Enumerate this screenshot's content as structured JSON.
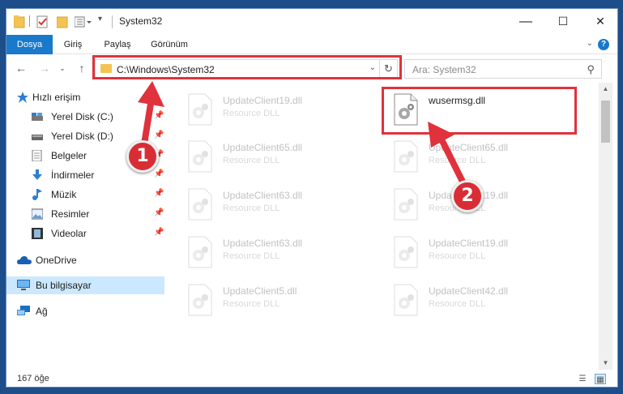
{
  "window": {
    "title": "System32",
    "controls": {
      "minimize": "—",
      "maximize": "☐",
      "close": "✕"
    }
  },
  "ribbon": {
    "tabs": [
      {
        "label": "Dosya",
        "active": true
      },
      {
        "label": "Giriş"
      },
      {
        "label": "Paylaş"
      },
      {
        "label": "Görünüm"
      }
    ],
    "help": "?"
  },
  "address": {
    "path": "C:\\Windows\\System32"
  },
  "search": {
    "placeholder": "Ara: System32"
  },
  "sidebar": {
    "items": [
      {
        "label": "Hızlı erişim",
        "icon": "star-icon",
        "pinned": false
      },
      {
        "label": "Yerel Disk (C:)",
        "icon": "drive-c-icon",
        "pinned": true
      },
      {
        "label": "Yerel Disk (D:)",
        "icon": "drive-icon",
        "pinned": true
      },
      {
        "label": "Belgeler",
        "icon": "document-icon",
        "pinned": true
      },
      {
        "label": "İndirmeler",
        "icon": "download-icon",
        "pinned": true
      },
      {
        "label": "Müzik",
        "icon": "music-icon",
        "pinned": true
      },
      {
        "label": "Resimler",
        "icon": "pictures-icon",
        "pinned": true
      },
      {
        "label": "Videolar",
        "icon": "video-icon",
        "pinned": true
      },
      {
        "label": "OneDrive",
        "icon": "cloud-icon"
      },
      {
        "label": "Bu bilgisayar",
        "icon": "computer-icon",
        "selected": true
      },
      {
        "label": "Ağ",
        "icon": "network-icon"
      }
    ]
  },
  "files": [
    {
      "name": "UpdateClient19.dll",
      "type": "Resource DLL",
      "faded": true
    },
    {
      "name": "wusermsg.dll",
      "type": "",
      "faded": false
    },
    {
      "name": "UpdateClient65.dll",
      "type": "Resource DLL",
      "faded": true
    },
    {
      "name": "UpdateClient65.dll",
      "type": "Resource DLL",
      "faded": true
    },
    {
      "name": "UpdateClient63.dll",
      "type": "Resource DLL",
      "faded": true
    },
    {
      "name": "UpdateClient19.dll",
      "type": "Resource DLL",
      "faded": true
    },
    {
      "name": "UpdateClient63.dll",
      "type": "Resource DLL",
      "faded": true
    },
    {
      "name": "UpdateClient19.dll",
      "type": "Resource DLL",
      "faded": true
    },
    {
      "name": "UpdateClient5.dll",
      "type": "Resource DLL",
      "faded": true
    },
    {
      "name": "UpdateClient42.dll",
      "type": "Resource DLL",
      "faded": true
    }
  ],
  "status": {
    "count": "167 öğe"
  },
  "annotations": {
    "step1": "1",
    "step2": "2",
    "color": "#e0323c"
  }
}
